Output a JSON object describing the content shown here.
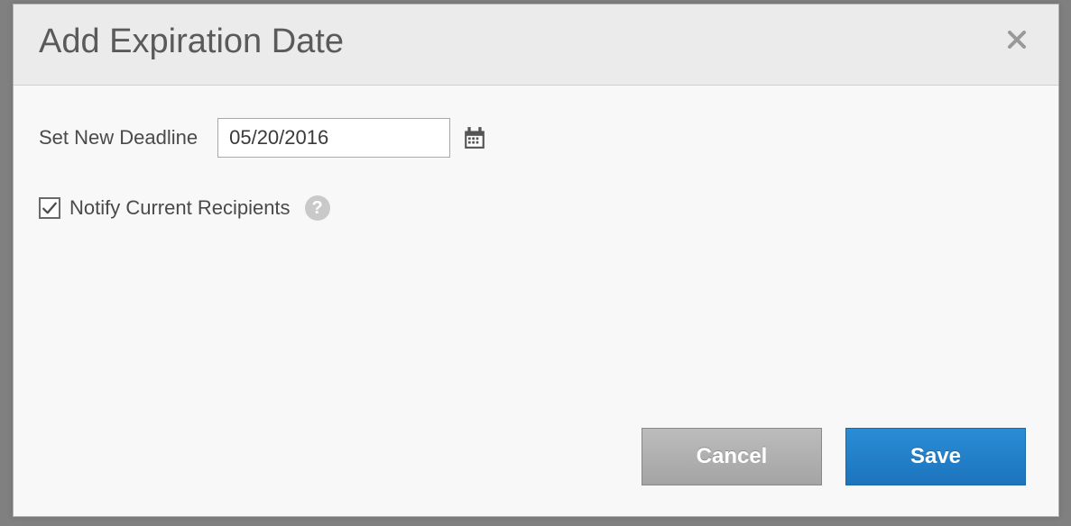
{
  "dialog": {
    "title": "Add Expiration Date",
    "field_label": "Set New Deadline",
    "deadline_value": "05/20/2016",
    "notify_label": "Notify Current Recipients",
    "notify_checked": true,
    "buttons": {
      "cancel": "Cancel",
      "save": "Save"
    }
  }
}
